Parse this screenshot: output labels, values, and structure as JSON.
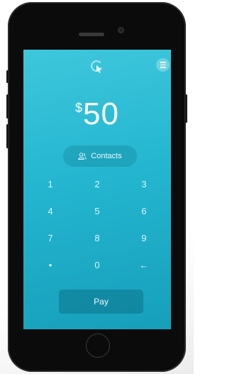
{
  "payment": {
    "currency_symbol": "$",
    "amount": "50"
  },
  "contacts_button": {
    "label": "Contacts"
  },
  "keypad": {
    "keys": [
      "1",
      "2",
      "3",
      "4",
      "5",
      "6",
      "7",
      "8",
      "9",
      "•",
      "0",
      "←"
    ]
  },
  "pay_button": {
    "label": "Pay"
  },
  "colors": {
    "screen_gradient_top": "#3ec7dc",
    "screen_gradient_bottom": "#169fbb",
    "phone_body": "#0b0b0b"
  }
}
